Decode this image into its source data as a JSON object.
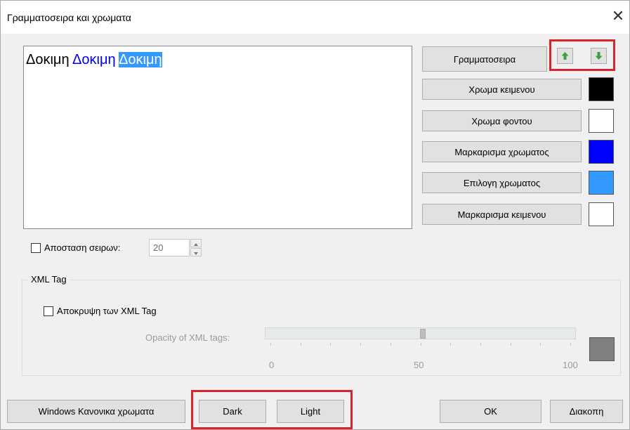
{
  "window": {
    "title": "Γραμματοσειρα και χρωματα"
  },
  "preview": {
    "normal_text": "Δοκιμη",
    "marked_text": "Δοκιμη",
    "selected_text": "Δοκιμη"
  },
  "buttons": {
    "font": "Γραμματοσειρα",
    "text_color": "Χρωμα κειμενου",
    "background_color": "Χρωμα φοντου",
    "marking_color": "Μαρκαρισμα χρωματος",
    "selection_color": "Επιλογη χρωματος",
    "text_marking": "Μαρκαρισμα κειμενου"
  },
  "swatches": {
    "text_color": "#000000",
    "background_color": "#ffffff",
    "marking_color": "#0000ff",
    "selection_color": "#3399ff",
    "text_marking": "#ffffff",
    "opacity_preview": "#808080"
  },
  "line_spacing": {
    "label": "Αποσταση σειρων:",
    "value": "20",
    "checked": false
  },
  "xml_group": {
    "title": "XML Tag",
    "hide_label": "Αποκρυψη των XML Tag",
    "hide_checked": false,
    "opacity_label": "Opacity of XML tags:",
    "slider_min": "0",
    "slider_mid": "50",
    "slider_max": "100",
    "slider_value": 50
  },
  "footer": {
    "windows_default": "Windows Κανονικα χρωματα",
    "dark": "Dark",
    "light": "Light",
    "ok": "OK",
    "cancel": "Διακοπη"
  },
  "accent": {
    "annotation": "#d9232d",
    "arrow": "#3aa23a"
  }
}
